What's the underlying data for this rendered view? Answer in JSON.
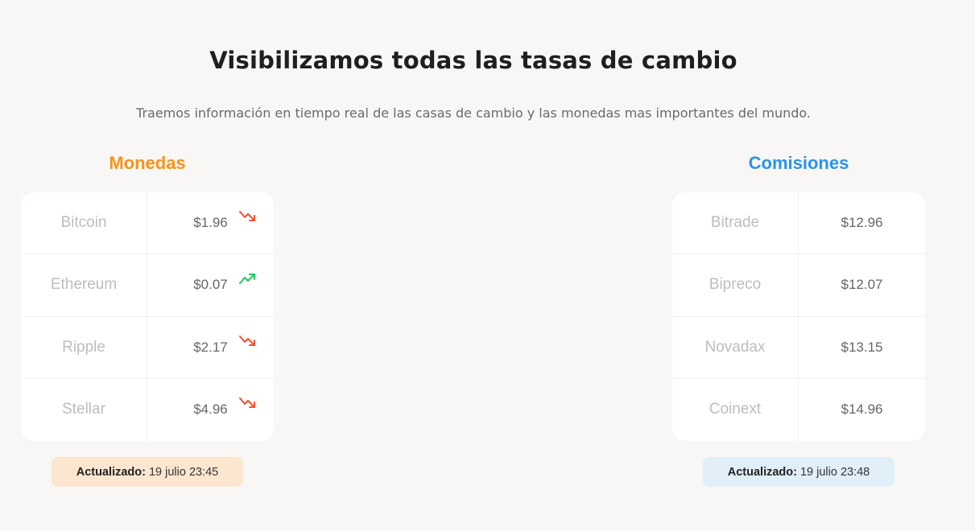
{
  "header": {
    "title": "Visibilizamos todas las tasas de cambio",
    "subtitle": "Traemos información en tiempo real de las casas de cambio y las monedas mas importantes del mundo."
  },
  "monedas": {
    "title": "Monedas",
    "title_color": "#f7931a",
    "rows": [
      {
        "name": "Bitcoin",
        "value": "$1.96",
        "trend": "down-trend-icon"
      },
      {
        "name": "Ethereum",
        "value": "$0.07",
        "trend": "up-trend-icon"
      },
      {
        "name": "Ripple",
        "value": "$2.17",
        "trend": "down-trend-icon"
      },
      {
        "name": "Stellar",
        "value": "$4.96",
        "trend": "down-trend-icon"
      }
    ],
    "updated_label": "Actualizado:",
    "updated_value": "19 julio 23:45"
  },
  "comisiones": {
    "title": "Comisiones",
    "title_color": "#2a93f0",
    "rows": [
      {
        "name": "Bitrade",
        "value": "$12.96"
      },
      {
        "name": "Bipreco",
        "value": "$12.07"
      },
      {
        "name": "Novadax",
        "value": "$13.15"
      },
      {
        "name": "Coinext",
        "value": "$14.96"
      }
    ],
    "updated_label": "Actualizado:",
    "updated_value": "19 julio 23:48"
  },
  "colors": {
    "trend_down": "#f0522d",
    "trend_up": "#22c55e"
  }
}
